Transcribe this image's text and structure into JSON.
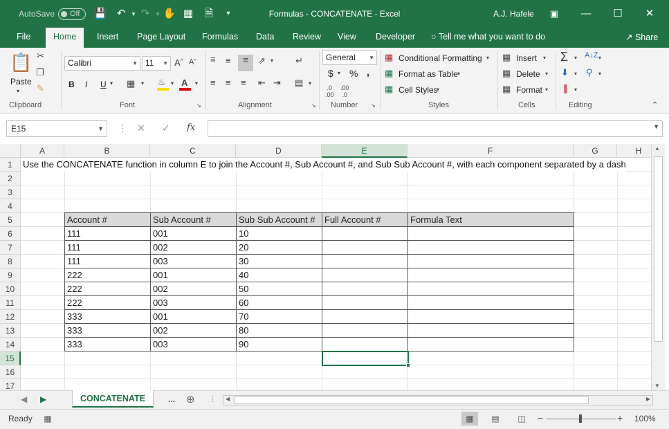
{
  "titlebar": {
    "autosave_label": "AutoSave",
    "autosave_state": "Off",
    "title": "Formulas - CONCATENATE  -  Excel",
    "user": "A.J. Hafele"
  },
  "tabs": [
    "File",
    "Home",
    "Insert",
    "Page Layout",
    "Formulas",
    "Data",
    "Review",
    "View",
    "Developer"
  ],
  "active_tab": "Home",
  "tell_me": "Tell me what you want to do",
  "share": "Share",
  "ribbon": {
    "clipboard": {
      "paste": "Paste",
      "label": "Clipboard"
    },
    "font": {
      "name": "Calibri",
      "size": "11",
      "label": "Font",
      "bold": "B",
      "italic": "I",
      "underline": "U"
    },
    "alignment": {
      "label": "Alignment"
    },
    "number": {
      "format": "General",
      "currency": "$",
      "percent": "%",
      "comma": ",",
      "label": "Number"
    },
    "styles": {
      "conditional": "Conditional Formatting",
      "format_table": "Format as Table",
      "cell_styles": "Cell Styles",
      "label": "Styles"
    },
    "cells": {
      "insert": "Insert",
      "delete": "Delete",
      "format": "Format",
      "label": "Cells"
    },
    "editing": {
      "label": "Editing"
    }
  },
  "formula_bar": {
    "name_box": "E15",
    "fx": "fx",
    "content": ""
  },
  "columns": [
    "A",
    "B",
    "C",
    "D",
    "E",
    "F",
    "G",
    "H"
  ],
  "selected_column": "E",
  "rows": [
    "1",
    "2",
    "3",
    "4",
    "5",
    "6",
    "7",
    "8",
    "9",
    "10",
    "11",
    "12",
    "13",
    "14",
    "15",
    "16",
    "17"
  ],
  "selected_row": "15",
  "instruction": "Use the CONCATENATE function in column E to join the Account #, Sub Account #, and Sub Sub Account #, with each component separated by a dash",
  "table": {
    "headers": [
      "Account #",
      "Sub Account #",
      "Sub Sub Account #",
      "Full Account #",
      "Formula Text"
    ],
    "rows": [
      [
        "111",
        "001",
        "10",
        "",
        ""
      ],
      [
        "111",
        "002",
        "20",
        "",
        ""
      ],
      [
        "111",
        "003",
        "30",
        "",
        ""
      ],
      [
        "222",
        "001",
        "40",
        "",
        ""
      ],
      [
        "222",
        "002",
        "50",
        "",
        ""
      ],
      [
        "222",
        "003",
        "60",
        "",
        ""
      ],
      [
        "333",
        "001",
        "70",
        "",
        ""
      ],
      [
        "333",
        "002",
        "80",
        "",
        ""
      ],
      [
        "333",
        "003",
        "90",
        "",
        ""
      ]
    ]
  },
  "sheet_tab": "CONCATENATE",
  "sheet_more": "...",
  "status": {
    "ready": "Ready",
    "zoom": "100%"
  },
  "colors": {
    "accent": "#217346",
    "header_fill": "#d9d9d9"
  }
}
